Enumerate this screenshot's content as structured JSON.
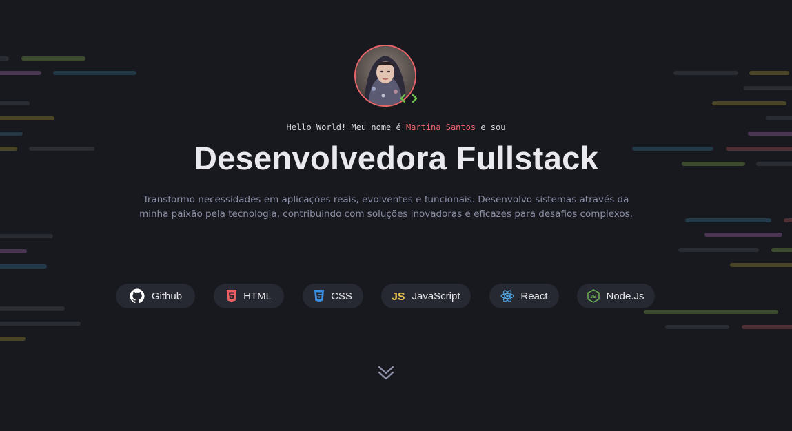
{
  "hero": {
    "avatar_alt": "Martina Santos",
    "code_badge_icon": "code-brackets-icon",
    "greeting_prefix": "Hello World! Meu nome é ",
    "greeting_name": "Martina Santos",
    "greeting_suffix": " e sou",
    "title": "Desenvolvedora Fullstack",
    "description": "Transformo necessidades em aplicações reais, evolventes e funcionais. Desenvolvo sistemas através da minha paixão pela tecnologia, contribuindo com soluções inovadoras e eficazes para desafios complexos."
  },
  "technologies": [
    {
      "label": "Github",
      "icon": "github-icon",
      "color": "#ffffff"
    },
    {
      "label": "HTML",
      "icon": "html5-icon",
      "color": "#e96060"
    },
    {
      "label": "CSS",
      "icon": "css3-icon",
      "color": "#3b8ee0"
    },
    {
      "label": "JavaScript",
      "icon": "javascript-icon",
      "color": "#e8c34a"
    },
    {
      "label": "React",
      "icon": "react-icon",
      "color": "#4ea3e0"
    },
    {
      "label": "Node.Js",
      "icon": "nodejs-icon",
      "color": "#6cb452"
    }
  ],
  "scroll_hint_icon": "chevron-double-down-icon",
  "colors": {
    "background": "#18191e",
    "accent": "#f0646b",
    "pill_bg": "#272932",
    "muted_text": "#8b8fa6"
  }
}
